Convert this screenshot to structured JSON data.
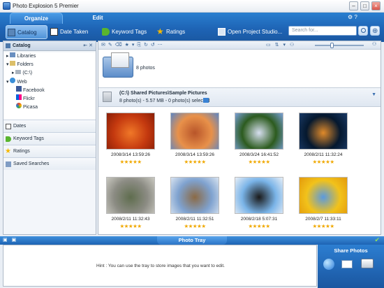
{
  "window": {
    "title": "Photo Explosion 5 Premier"
  },
  "tabs": [
    {
      "label": "Organize"
    },
    {
      "label": "Edit"
    }
  ],
  "nav": [
    {
      "label": "Catalog",
      "icon": "catalog-icon"
    },
    {
      "label": "Date Taken",
      "icon": "calendar-icon"
    },
    {
      "label": "Keyword Tags",
      "icon": "tag-icon"
    },
    {
      "label": "Ratings",
      "icon": "star-icon"
    },
    {
      "label": "Open Project Studio...",
      "icon": "project-studio-icon"
    }
  ],
  "search": {
    "placeholder": "Search for..."
  },
  "sidebar": {
    "header": "Catalog",
    "tree": {
      "libraries": "Libraries",
      "folders": "Folders",
      "drive": "(C:\\)",
      "web": "Web",
      "facebook": "Facebook",
      "flickr": "Flickr",
      "picasa": "Picasa"
    },
    "sections": [
      {
        "label": "Dates"
      },
      {
        "label": "Keyword Tags"
      },
      {
        "label": "Ratings"
      },
      {
        "label": "Saved Searches"
      }
    ]
  },
  "folder_preview": {
    "count": "8 photos"
  },
  "collection": {
    "path": "(C:\\) Shared Pictures\\Sample Pictures",
    "summary": "8 photo(s) - 5.57 MB - 0 photo(s) selected"
  },
  "photos": [
    {
      "date": "2008/3/14 13:59:26",
      "rating": 5,
      "colors": [
        "#c4390f",
        "#f07828",
        "#8a1e07"
      ]
    },
    {
      "date": "2008/3/14 13:59:26",
      "rating": 5,
      "colors": [
        "#e8914a",
        "#b8552a",
        "#5d86c4"
      ]
    },
    {
      "date": "2008/3/24 16:41:52",
      "rating": 5,
      "colors": [
        "#2c5b1e",
        "#d7dff0",
        "#7aa0d8"
      ]
    },
    {
      "date": "2008/2/11 11:32:24",
      "rating": 5,
      "colors": [
        "#05182e",
        "#e08a2a",
        "#1a3a66"
      ]
    },
    {
      "date": "2008/2/11 11:32:43",
      "rating": 5,
      "colors": [
        "#8c8c84",
        "#5f6d4e",
        "#c9c8c0"
      ]
    },
    {
      "date": "2008/2/11 11:32:51",
      "rating": 5,
      "colors": [
        "#7fa2cf",
        "#8b6a45",
        "#d8e3f0"
      ]
    },
    {
      "date": "2008/2/18 5:07:31",
      "rating": 5,
      "colors": [
        "#7ab4e8",
        "#1a1a1a",
        "#e8eef6"
      ]
    },
    {
      "date": "2008/2/7 11:33:11",
      "rating": 5,
      "colors": [
        "#f2c21a",
        "#5a9ae0",
        "#e39a0c"
      ]
    }
  ],
  "tray": {
    "title": "Photo Tray",
    "hint": "Hint : You can use the tray to store images that you want to edit."
  },
  "share": {
    "title": "Share Photos"
  }
}
